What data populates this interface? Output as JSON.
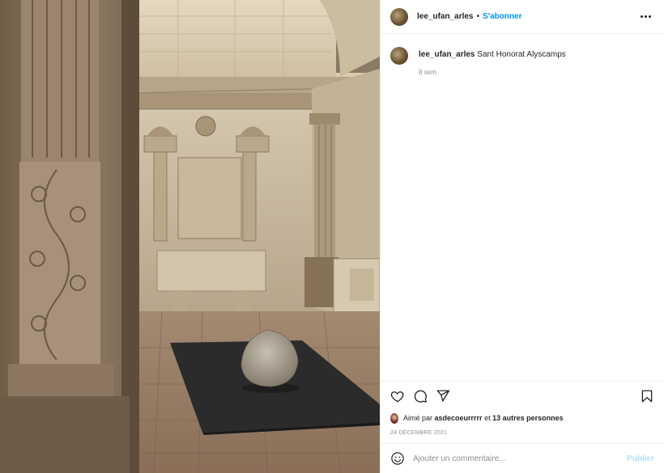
{
  "post": {
    "username": "lee_ufan_arles",
    "separator": "•",
    "follow_label": "S'abonner",
    "caption": {
      "username": "lee_ufan_arles",
      "text": "Sant Honorat Alyscamps",
      "time_ago": "8 sem"
    },
    "likes": {
      "prefix": "Aimé par",
      "first_liker": "asdecoeurrrrr",
      "conj": "et",
      "others": "13 autres personnes"
    },
    "date": "24 DÉCEMBRE 2021",
    "comment": {
      "placeholder": "Ajouter un commentaire...",
      "publish_label": "Publier"
    }
  },
  "icons": {
    "more": "more-horizontal-icon",
    "like": "heart-icon",
    "comment": "comment-icon",
    "share": "paper-plane-icon",
    "save": "bookmark-icon",
    "emoji": "smiley-icon"
  },
  "colors": {
    "accent": "#0095f6",
    "publish_disabled": "#b2dffc",
    "muted": "#8e8e8e",
    "text": "#262626"
  }
}
